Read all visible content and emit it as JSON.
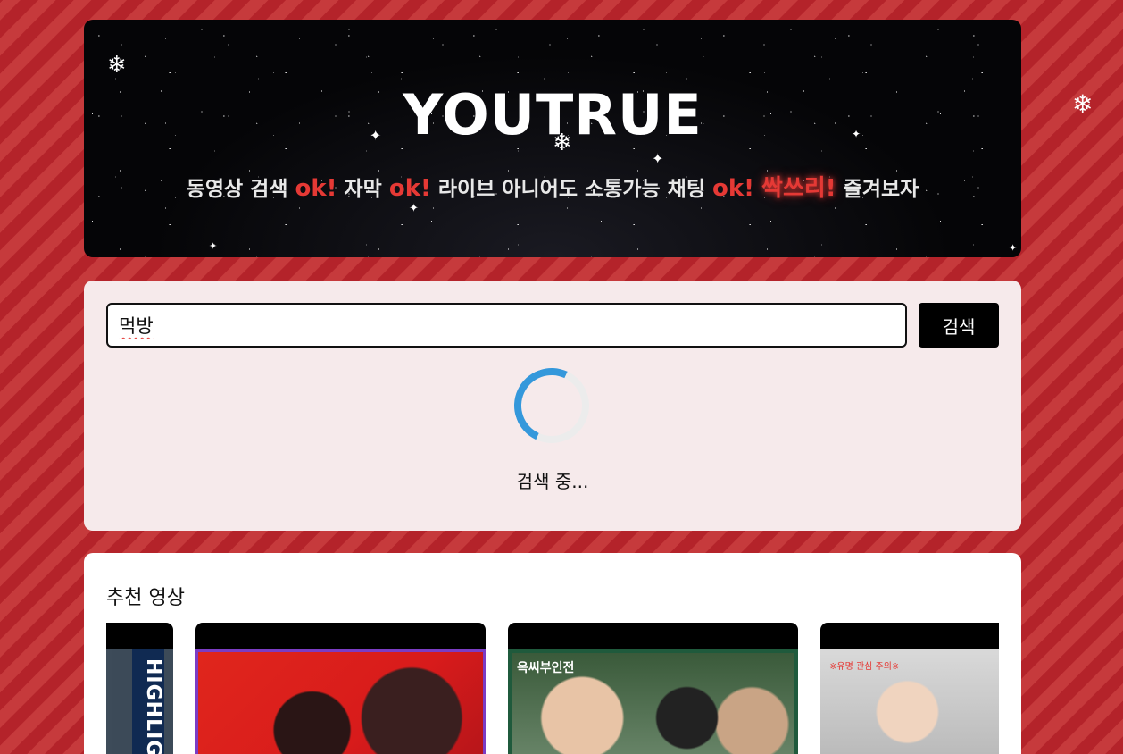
{
  "hero": {
    "title": "YOUTRUE",
    "subtitle": {
      "p1": "동영상 검색 ",
      "ok1": "ok!",
      "p2": " 자막 ",
      "ok2": "ok!",
      "p3": " 라이브 아니어도 소통가능 채팅 ",
      "ok3": "ok!",
      "hot": "싹쓰리!",
      "p4": " 즐겨보자"
    },
    "snow_icon": "❄"
  },
  "search": {
    "value": "먹방",
    "button_label": "검색",
    "loading_text": "검색 중..."
  },
  "recommended": {
    "title": "추천 영상",
    "thumbs": [
      {
        "overlay": "HIGHLIGHTS"
      },
      {
        "overlay": ""
      },
      {
        "overlay": "옥씨부인전"
      },
      {
        "overlay": "※유명 관심 주의※"
      }
    ]
  },
  "colors": {
    "accent_red": "#e53935",
    "spinner_blue": "#3498db",
    "background_red": "#b8262a"
  }
}
